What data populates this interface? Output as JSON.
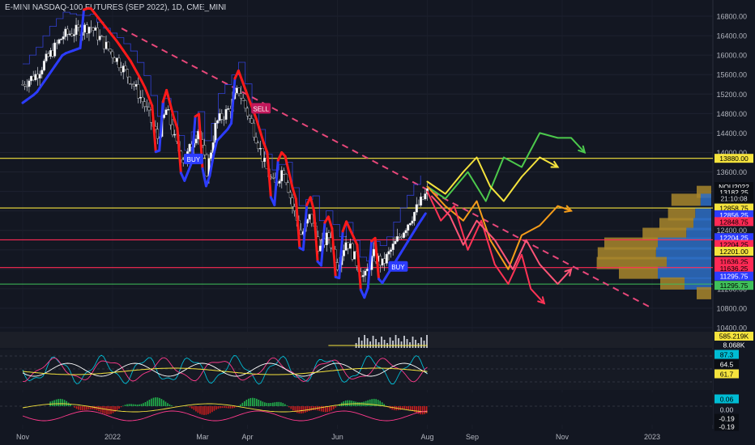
{
  "header": {
    "title": "E-MINI NASDAQ-100 FUTURES (SEP 2022), 1D, CME_MINI"
  },
  "colors": {
    "background": "#131722",
    "bull_candle": "#ffffff",
    "bear_candle": "#000000",
    "trend_red": "#ff1a1a",
    "trend_blue": "#2c3cff",
    "downtrend_line": "#e8477a",
    "resistance_yellow": "#f5e33d",
    "support_red": "#ff2a55",
    "support_green": "#3fbf5a",
    "path_green": "#4cc94c",
    "path_yellow": "#f5e33d",
    "path_orange": "#f59c1a",
    "path_red": "#ff3355",
    "path_pink": "#ff5577",
    "volume_profile_gold": "#a8862b",
    "volume_profile_blue": "#2e6fc4"
  },
  "chart_data": {
    "type": "candlestick",
    "title": "E-MINI NASDAQ-100 FUTURES (SEP 2022), 1D, CME_MINI",
    "symbol": "NQU2022",
    "ylim": [
      10400,
      17000
    ],
    "y_ticks": [
      "16800.00",
      "16400.00",
      "16000.00",
      "15600.00",
      "15200.00",
      "14800.00",
      "14400.00",
      "14000.00",
      "13600.00",
      "13200.00",
      "12800.00",
      "12400.00",
      "12000.00",
      "11600.00",
      "11200.00",
      "10800.00",
      "10400.00"
    ],
    "x_ticks": [
      {
        "label": "Nov",
        "m": 0
      },
      {
        "label": "2022",
        "m": 2
      },
      {
        "label": "Mar",
        "m": 4
      },
      {
        "label": "Apr",
        "m": 5
      },
      {
        "label": "Jun",
        "m": 7
      },
      {
        "label": "Aug",
        "m": 9
      },
      {
        "label": "Sep",
        "m": 10
      },
      {
        "label": "Nov",
        "m": 12
      },
      {
        "label": "2023",
        "m": 14
      }
    ],
    "price_path": [
      [
        0,
        15400
      ],
      [
        0.3,
        15600
      ],
      [
        0.6,
        16000
      ],
      [
        0.9,
        16400
      ],
      [
        1.2,
        16500
      ],
      [
        1.5,
        16600
      ],
      [
        1.8,
        16250
      ],
      [
        2.1,
        15900
      ],
      [
        2.4,
        15500
      ],
      [
        2.7,
        15000
      ],
      [
        3.0,
        14300
      ],
      [
        3.2,
        14900
      ],
      [
        3.4,
        14200
      ],
      [
        3.6,
        13800
      ],
      [
        3.9,
        14500
      ],
      [
        4.1,
        13600
      ],
      [
        4.3,
        14600
      ],
      [
        4.6,
        14900
      ],
      [
        4.8,
        15300
      ],
      [
        5.0,
        14800
      ],
      [
        5.2,
        14300
      ],
      [
        5.4,
        13700
      ],
      [
        5.6,
        13300
      ],
      [
        5.8,
        13700
      ],
      [
        6.0,
        12900
      ],
      [
        6.2,
        12300
      ],
      [
        6.4,
        12700
      ],
      [
        6.6,
        12000
      ],
      [
        6.8,
        12300
      ],
      [
        7.0,
        11700
      ],
      [
        7.2,
        12200
      ],
      [
        7.4,
        11800
      ],
      [
        7.6,
        11400
      ],
      [
        7.8,
        11900
      ],
      [
        8.0,
        11700
      ],
      [
        8.2,
        12000
      ],
      [
        8.4,
        12300
      ],
      [
        8.6,
        12600
      ],
      [
        8.8,
        12900
      ],
      [
        9.0,
        13182
      ]
    ],
    "signals": [
      {
        "label": "BUY",
        "m": 3.8,
        "price": 13860,
        "color": "#2c3cff"
      },
      {
        "label": "SELL",
        "m": 5.3,
        "price": 14900,
        "color": "#c2185b"
      },
      {
        "label": "BUY",
        "m": 8.35,
        "price": 11650,
        "color": "#2c3cff"
      }
    ],
    "horizontal_levels": [
      {
        "price": 13880,
        "color": "#f5e33d"
      },
      {
        "price": 12858.75,
        "color": "#f5e33d"
      },
      {
        "price": 12204.25,
        "color": "#ff2a55"
      },
      {
        "price": 11636.25,
        "color": "#ff2a55"
      },
      {
        "price": 11295.75,
        "color": "#3fbf5a"
      }
    ],
    "downtrend_line": [
      [
        2.2,
        16550
      ],
      [
        14.0,
        10800
      ]
    ],
    "price_labels": [
      {
        "text": "13880.00",
        "price": 13880,
        "bg": "#f5e33d",
        "fg": "#000000"
      },
      {
        "text": "NQU2022",
        "price": 13300,
        "bg": "#0b0e14",
        "fg": "#ffffff"
      },
      {
        "text": "13182.25",
        "price": 13182.25,
        "bg": "#0b0e14",
        "fg": "#ffffff"
      },
      {
        "text": "21:10:08",
        "price": 13060,
        "bg": "#0b0e14",
        "fg": "#d1d4dc"
      },
      {
        "text": "12858.75",
        "price": 12858.75,
        "bg": "#f5e33d",
        "fg": "#000000"
      },
      {
        "text": "12856.25",
        "price": 12720,
        "bg": "#2c3cff",
        "fg": "#ffffff"
      },
      {
        "text": "12848.75",
        "price": 12580,
        "bg": "#ff2a55",
        "fg": "#000000"
      },
      {
        "text": "12204.25",
        "price": 12250,
        "bg": "#2c3cff",
        "fg": "#ffffff"
      },
      {
        "text": "12204.25",
        "price": 12110,
        "bg": "#ff2a55",
        "fg": "#000000"
      },
      {
        "text": "12201.00",
        "price": 11970,
        "bg": "#f5e33d",
        "fg": "#000000"
      },
      {
        "text": "11636.25",
        "price": 11760,
        "bg": "#ff2a55",
        "fg": "#000000"
      },
      {
        "text": "11636.25",
        "price": 11620,
        "bg": "#ff2a55",
        "fg": "#000000"
      },
      {
        "text": "11295.75",
        "price": 11460,
        "bg": "#2c3cff",
        "fg": "#ffffff"
      },
      {
        "text": "11295.75",
        "price": 11270,
        "bg": "#3fbf5a",
        "fg": "#000000"
      }
    ],
    "scenario_paths": [
      {
        "color": "#4cc94c",
        "points": [
          [
            9.0,
            13300
          ],
          [
            9.4,
            13050
          ],
          [
            9.9,
            13600
          ],
          [
            10.3,
            13000
          ],
          [
            10.7,
            13900
          ],
          [
            11.1,
            13700
          ],
          [
            11.5,
            14400
          ],
          [
            11.9,
            14300
          ],
          [
            12.2,
            14300
          ],
          [
            12.5,
            14000
          ]
        ]
      },
      {
        "color": "#f5e33d",
        "points": [
          [
            9.0,
            13400
          ],
          [
            9.4,
            13150
          ],
          [
            9.8,
            13600
          ],
          [
            10.1,
            13900
          ],
          [
            10.4,
            13300
          ],
          [
            10.7,
            13000
          ],
          [
            11.1,
            13500
          ],
          [
            11.5,
            13900
          ],
          [
            11.9,
            13700
          ]
        ]
      },
      {
        "color": "#f59c1a",
        "points": [
          [
            9.0,
            13300
          ],
          [
            9.4,
            12900
          ],
          [
            9.8,
            12600
          ],
          [
            10.1,
            13000
          ],
          [
            10.4,
            12200
          ],
          [
            10.8,
            11600
          ],
          [
            11.1,
            12300
          ],
          [
            11.5,
            12500
          ],
          [
            11.9,
            12900
          ],
          [
            12.2,
            12800
          ]
        ]
      },
      {
        "color": "#ff3355",
        "points": [
          [
            9.0,
            13200
          ],
          [
            9.3,
            12600
          ],
          [
            9.6,
            12900
          ],
          [
            9.9,
            12000
          ],
          [
            10.2,
            12600
          ],
          [
            10.5,
            11700
          ],
          [
            10.8,
            11300
          ],
          [
            11.1,
            11900
          ],
          [
            11.3,
            11200
          ],
          [
            11.6,
            10900
          ]
        ]
      },
      {
        "color": "#ff5577",
        "points": [
          [
            9.1,
            13100
          ],
          [
            9.5,
            12700
          ],
          [
            9.8,
            12100
          ],
          [
            10.1,
            12600
          ],
          [
            10.5,
            12200
          ],
          [
            10.9,
            11600
          ],
          [
            11.2,
            12200
          ],
          [
            11.5,
            11700
          ],
          [
            11.9,
            11300
          ],
          [
            12.2,
            11600
          ]
        ]
      }
    ],
    "volume_profile": [
      {
        "price": 13182,
        "gold": 0.15,
        "blue": 0.0
      },
      {
        "price": 13020,
        "gold": 0.3,
        "blue": 0.12
      },
      {
        "price": 12720,
        "gold": 0.28,
        "blue": 0.18
      },
      {
        "price": 12520,
        "gold": 0.35,
        "blue": 0.2
      },
      {
        "price": 12320,
        "gold": 0.45,
        "blue": 0.28
      },
      {
        "price": 12120,
        "gold": 0.55,
        "blue": 0.6
      },
      {
        "price": 11920,
        "gold": 0.6,
        "blue": 0.62
      },
      {
        "price": 11720,
        "gold": 0.72,
        "blue": 0.5
      },
      {
        "price": 11520,
        "gold": 0.4,
        "blue": 0.6
      },
      {
        "price": 11300,
        "gold": 0.25,
        "blue": 0.3
      },
      {
        "price": 11100,
        "gold": 0.15,
        "blue": 0.0
      }
    ],
    "volume_labels": [
      "585.219K",
      "8.068K"
    ],
    "osc1_labels": [
      {
        "text": "87.3",
        "bg": "#00bcd4",
        "fg": "#000000"
      },
      {
        "text": "64.5",
        "bg": "#0b0e14",
        "fg": "#ffffff"
      },
      {
        "text": "61.7",
        "bg": "#f5e33d",
        "fg": "#000000"
      }
    ],
    "osc2_labels": [
      {
        "text": "0.06",
        "bg": "#00bcd4",
        "fg": "#000000"
      },
      {
        "text": "0.00",
        "bg": "#131722",
        "fg": "#d1d4dc"
      },
      {
        "text": "-0.19",
        "bg": "#0b0e14",
        "fg": "#ffffff"
      },
      {
        "text": "-0.19",
        "bg": "#0b0e14",
        "fg": "#ffffff"
      }
    ]
  }
}
